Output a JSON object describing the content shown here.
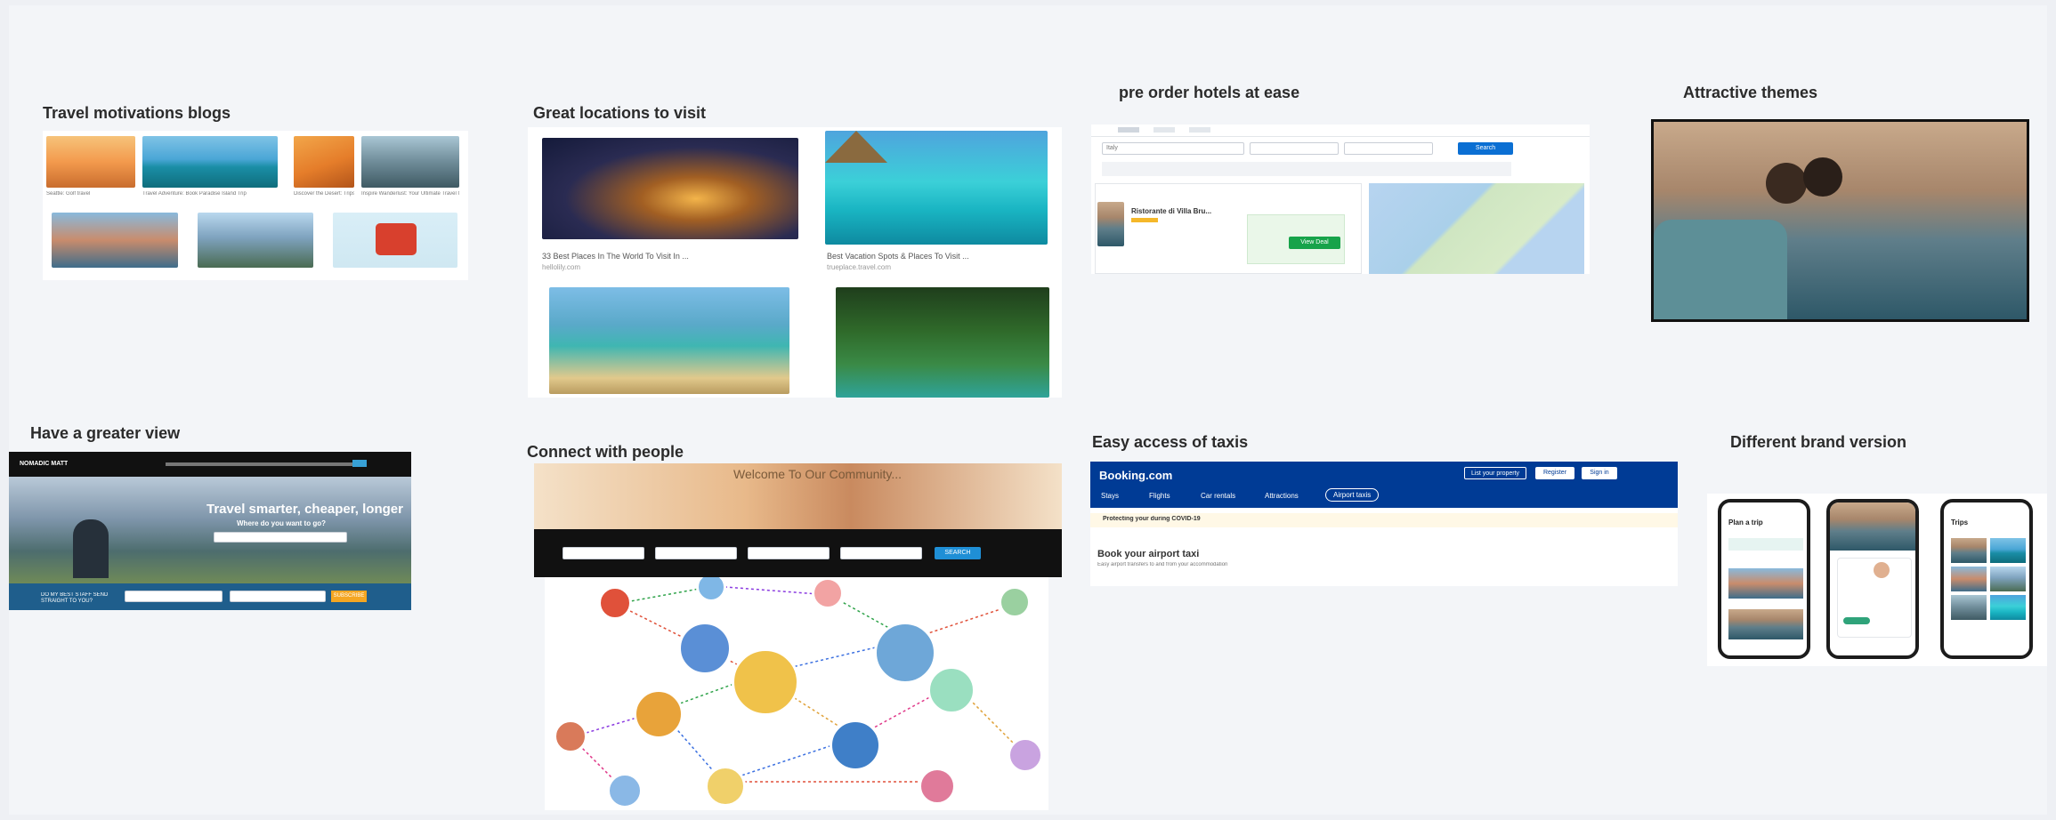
{
  "cards": {
    "travel_blogs": {
      "title": "Travel motivations blogs",
      "captions": [
        "Seattle: Golf travel",
        "Travel Adventure: Book Paradise Island Trip",
        "Discover the Desert: Trips",
        "Inspire Wanderlust: Your Ultimate Travel Guide"
      ]
    },
    "great_locations": {
      "title": "Great locations to visit",
      "items": [
        {
          "caption": "33 Best Places In The World To Visit In ...",
          "source": "hellolily.com"
        },
        {
          "caption": "Best Vacation Spots & Places To Visit ...",
          "source": "trueplace.travel.com"
        }
      ]
    },
    "hotels": {
      "title": "pre order hotels at ease",
      "search_placeholder": "Italy",
      "search_button": "Search",
      "listing_title": "Ristorante di Villa Bru...",
      "deal_button": "View Deal"
    },
    "themes": {
      "title": "Attractive themes"
    },
    "greater_view": {
      "title": "Have a greater view",
      "logo": "NOMADIC MATT",
      "headline": "Travel smarter, cheaper, longer",
      "subheadline": "Where do you want to go?",
      "cta": "SUBSCRIBE",
      "footer_text": "DO MY BEST STAFF SEND STRAIGHT TO YOU?"
    },
    "connect": {
      "title": "Connect with people",
      "banner_text": "Welcome To Our Community...",
      "search_button": "SEARCH"
    },
    "taxis": {
      "title": "Easy access of taxis",
      "brand": "Booking.com",
      "tabs": [
        "Stays",
        "Flights",
        "Car rentals",
        "Attractions",
        "Airport taxis"
      ],
      "header_buttons": [
        "List your property",
        "Register",
        "Sign in"
      ],
      "notice": "Protecting your during COVID-19",
      "heading": "Book your airport taxi",
      "subheading": "Easy airport transfers to and from your accommodation"
    },
    "brand_version": {
      "title": "Different brand version",
      "screens": [
        "Plan a trip",
        "",
        "Trips"
      ]
    }
  }
}
